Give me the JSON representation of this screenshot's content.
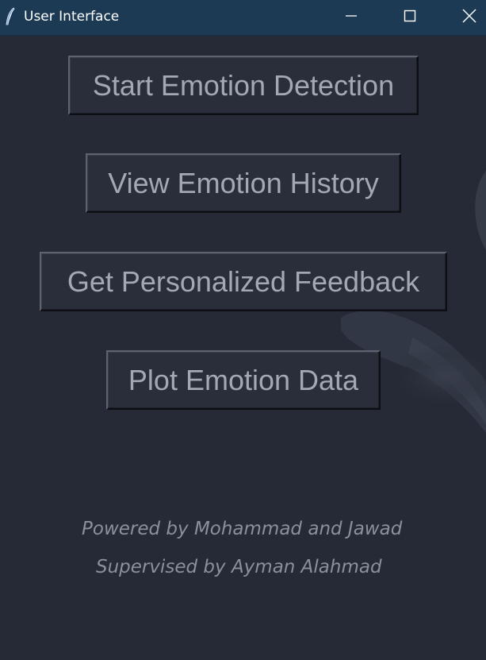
{
  "window": {
    "title": "User Interface",
    "app_icon": "feather-icon",
    "controls": {
      "minimize": "minimize-icon",
      "maximize": "maximize-icon",
      "close": "close-icon"
    }
  },
  "buttons": {
    "start_detection": "Start Emotion Detection",
    "view_history": "View Emotion History",
    "personalized_feedback": "Get Personalized Feedback",
    "plot_data": "Plot Emotion Data"
  },
  "footer": {
    "powered_by": "Powered by Mohammad and Jawad",
    "supervised_by": "Supervised by Ayman Alahmad"
  },
  "colors": {
    "background": "#262a36",
    "titlebar": "#1d3a55",
    "button_text": "#a3a8b3",
    "footer_text": "#8c909b"
  }
}
